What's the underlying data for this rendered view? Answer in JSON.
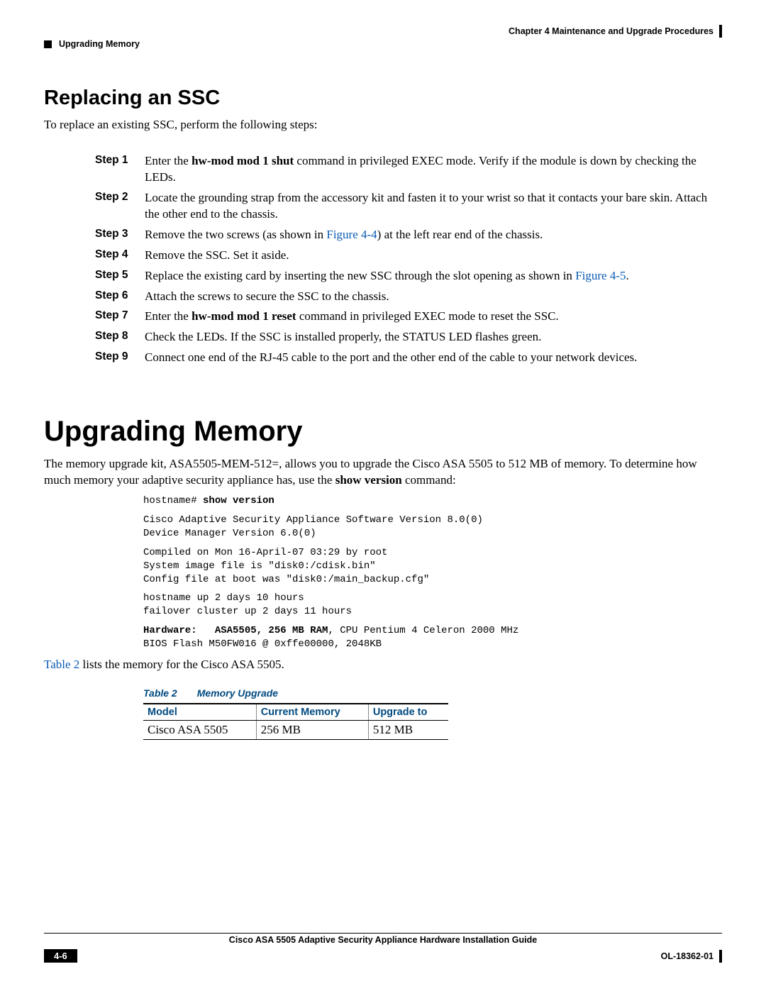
{
  "header": {
    "chapter": "Chapter 4    Maintenance and Upgrade Procedures",
    "topic": "Upgrading Memory"
  },
  "section1": {
    "title": "Replacing an SSC",
    "intro": "To replace an existing SSC, perform the following steps:",
    "steps": [
      {
        "label": "Step 1",
        "pre": "Enter the ",
        "bold": "hw-mod mod 1 shut",
        "post": " command in privileged EXEC mode. Verify if the module is down by checking the LEDs."
      },
      {
        "label": "Step 2",
        "text": "Locate the grounding strap from the accessory kit and fasten it to your wrist so that it contacts your bare skin. Attach the other end to the chassis."
      },
      {
        "label": "Step 3",
        "pre": "Remove the two screws (as shown in ",
        "link": "Figure 4-4",
        "post": ") at the left rear end of the chassis."
      },
      {
        "label": "Step 4",
        "text": "Remove the SSC. Set it aside."
      },
      {
        "label": "Step 5",
        "pre": "Replace the existing card by inserting the new SSC through the slot opening as shown in ",
        "link": "Figure 4-5",
        "post": "."
      },
      {
        "label": "Step 6",
        "text": "Attach the screws to secure the SSC to the chassis."
      },
      {
        "label": "Step 7",
        "pre": "Enter the ",
        "bold": "hw-mod mod 1 reset",
        "post": " command in privileged EXEC mode to reset the SSC."
      },
      {
        "label": "Step 8",
        "text": "Check the LEDs. If the SSC is installed properly, the STATUS LED flashes green."
      },
      {
        "label": "Step 9",
        "text": "Connect one end of the RJ-45 cable to the port and the other end of the cable to your network devices."
      }
    ]
  },
  "section2": {
    "title": "Upgrading Memory",
    "intro_pre": "The memory upgrade kit, ASA5505-MEM-512=, allows you to upgrade the Cisco ASA 5505 to 512 MB of memory. To determine how much memory your adaptive security appliance has, use the ",
    "intro_bold": "show version",
    "intro_post": " command:",
    "cli_prompt": "hostname# ",
    "cli_cmd": "show version",
    "cli_out1": "Cisco Adaptive Security Appliance Software Version 8.0(0)\nDevice Manager Version 6.0(0)",
    "cli_out2": "Compiled on Mon 16-April-07 03:29 by root\nSystem image file is \"disk0:/cdisk.bin\"\nConfig file at boot was \"disk0:/main_backup.cfg\"",
    "cli_out3": "hostname up 2 days 10 hours\nfailover cluster up 2 days 11 hours",
    "cli_hw_bold": "Hardware:   ASA5505, 256 MB RAM",
    "cli_hw_rest": ", CPU Pentium 4 Celeron 2000 MHz\nBIOS Flash M50FW016 @ 0xffe00000, 2048KB",
    "table_ref_link": "Table 2",
    "table_ref_post": " lists the memory for the Cisco ASA 5505.",
    "table_caption_pre": "Table 2",
    "table_caption": "Memory Upgrade",
    "table": {
      "headers": [
        "Model",
        "Current Memory",
        "Upgrade to"
      ],
      "row": [
        "Cisco ASA 5505",
        "256 MB",
        "512 MB"
      ]
    }
  },
  "footer": {
    "guide": "Cisco ASA 5505 Adaptive Security Appliance Hardware Installation Guide",
    "page": "4-6",
    "code": "OL-18362-01"
  }
}
